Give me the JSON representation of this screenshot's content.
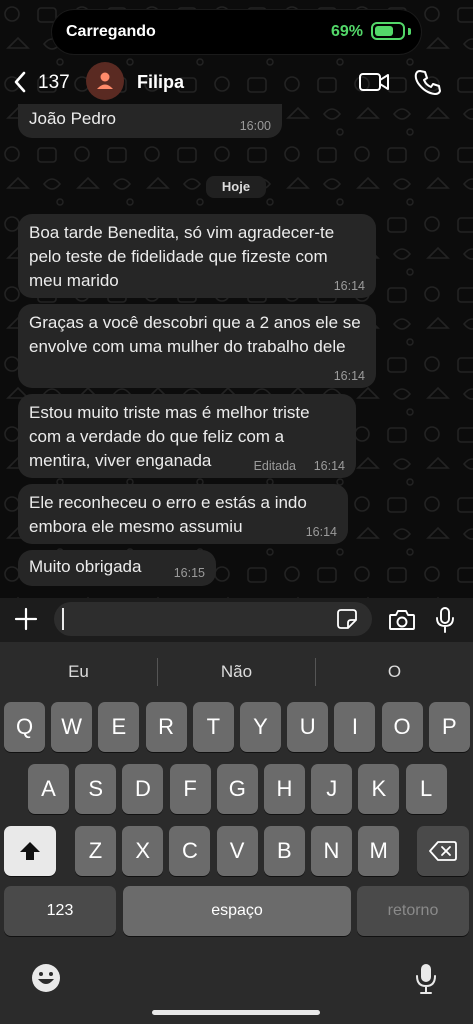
{
  "status_bar": {
    "label": "Carregando",
    "battery_percent": "69%",
    "battery_level": 0.69,
    "accent": "#53d769"
  },
  "header": {
    "back_count": "137",
    "contact_name": "Filipa"
  },
  "messages": [
    {
      "text": "João Pedro",
      "time": "16:00"
    },
    {
      "text": "Boa tarde Benedita, só vim agradecer-te pelo teste de fidelidade que fizeste com meu marido",
      "time": "16:14"
    },
    {
      "text": "Graças a você descobri que a 2 anos ele se envolve com uma mulher do trabalho dele",
      "time": "16:14"
    },
    {
      "text": "Estou muito triste mas é melhor triste com a verdade do que feliz com a mentira, viver enganada",
      "time": "16:14",
      "edited": "Editada"
    },
    {
      "text": "Ele reconheceu o erro e estás a indo embora ele mesmo assumiu",
      "time": "16:14"
    },
    {
      "text": "Muito obrigada",
      "time": "16:15"
    }
  ],
  "date_chip": "Hoje",
  "input": {
    "value": "",
    "placeholder": ""
  },
  "keyboard": {
    "suggestions": [
      "Eu",
      "Não",
      "O"
    ],
    "row1": [
      "Q",
      "W",
      "E",
      "R",
      "T",
      "Y",
      "U",
      "I",
      "O",
      "P"
    ],
    "row2": [
      "A",
      "S",
      "D",
      "F",
      "G",
      "H",
      "J",
      "K",
      "L"
    ],
    "row3": [
      "Z",
      "X",
      "C",
      "V",
      "B",
      "N",
      "M"
    ],
    "numbers_key": "123",
    "space_key": "espaço",
    "return_key": "retorno"
  },
  "icons": [
    "chevron-left-icon",
    "person-icon",
    "video-icon",
    "phone-icon",
    "plus-icon",
    "sticker-icon",
    "camera-icon",
    "mic-icon",
    "shift-icon",
    "backspace-icon",
    "emoji-icon",
    "keyboard-mic-icon"
  ]
}
